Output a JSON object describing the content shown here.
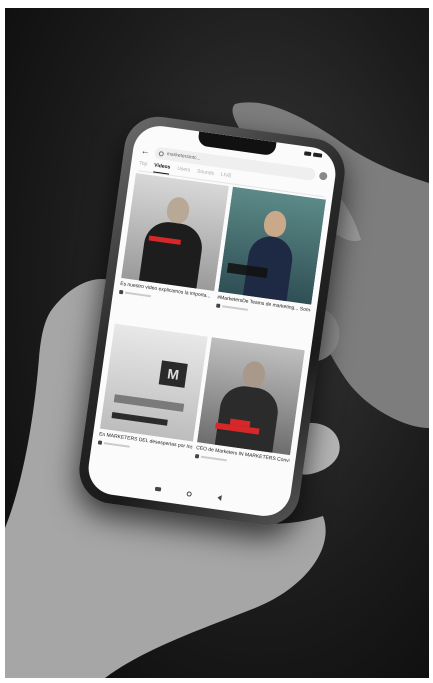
{
  "search": {
    "query": "marketersintc..."
  },
  "tabs": [
    {
      "label": "Top"
    },
    {
      "label": "Videos"
    },
    {
      "label": "Users"
    },
    {
      "label": "Sounds"
    },
    {
      "label": "LIVE"
    }
  ],
  "videos": [
    {
      "title": "Es nuestro video explicamos la importa..."
    },
    {
      "title": "#MarketersDe Teams de marketing... Somos..."
    },
    {
      "title": "En MARKETERS DEL desespertas por Instat..."
    },
    {
      "title": "CEO de Marketers IN MARKETERS Conviér..."
    }
  ],
  "colors": {
    "accent_red": "#d62828",
    "background_dark": "#1c1c1c"
  },
  "icons": [
    "back-arrow-icon",
    "search-icon",
    "clear-icon",
    "home-icon",
    "menu-icon",
    "back-icon"
  ]
}
